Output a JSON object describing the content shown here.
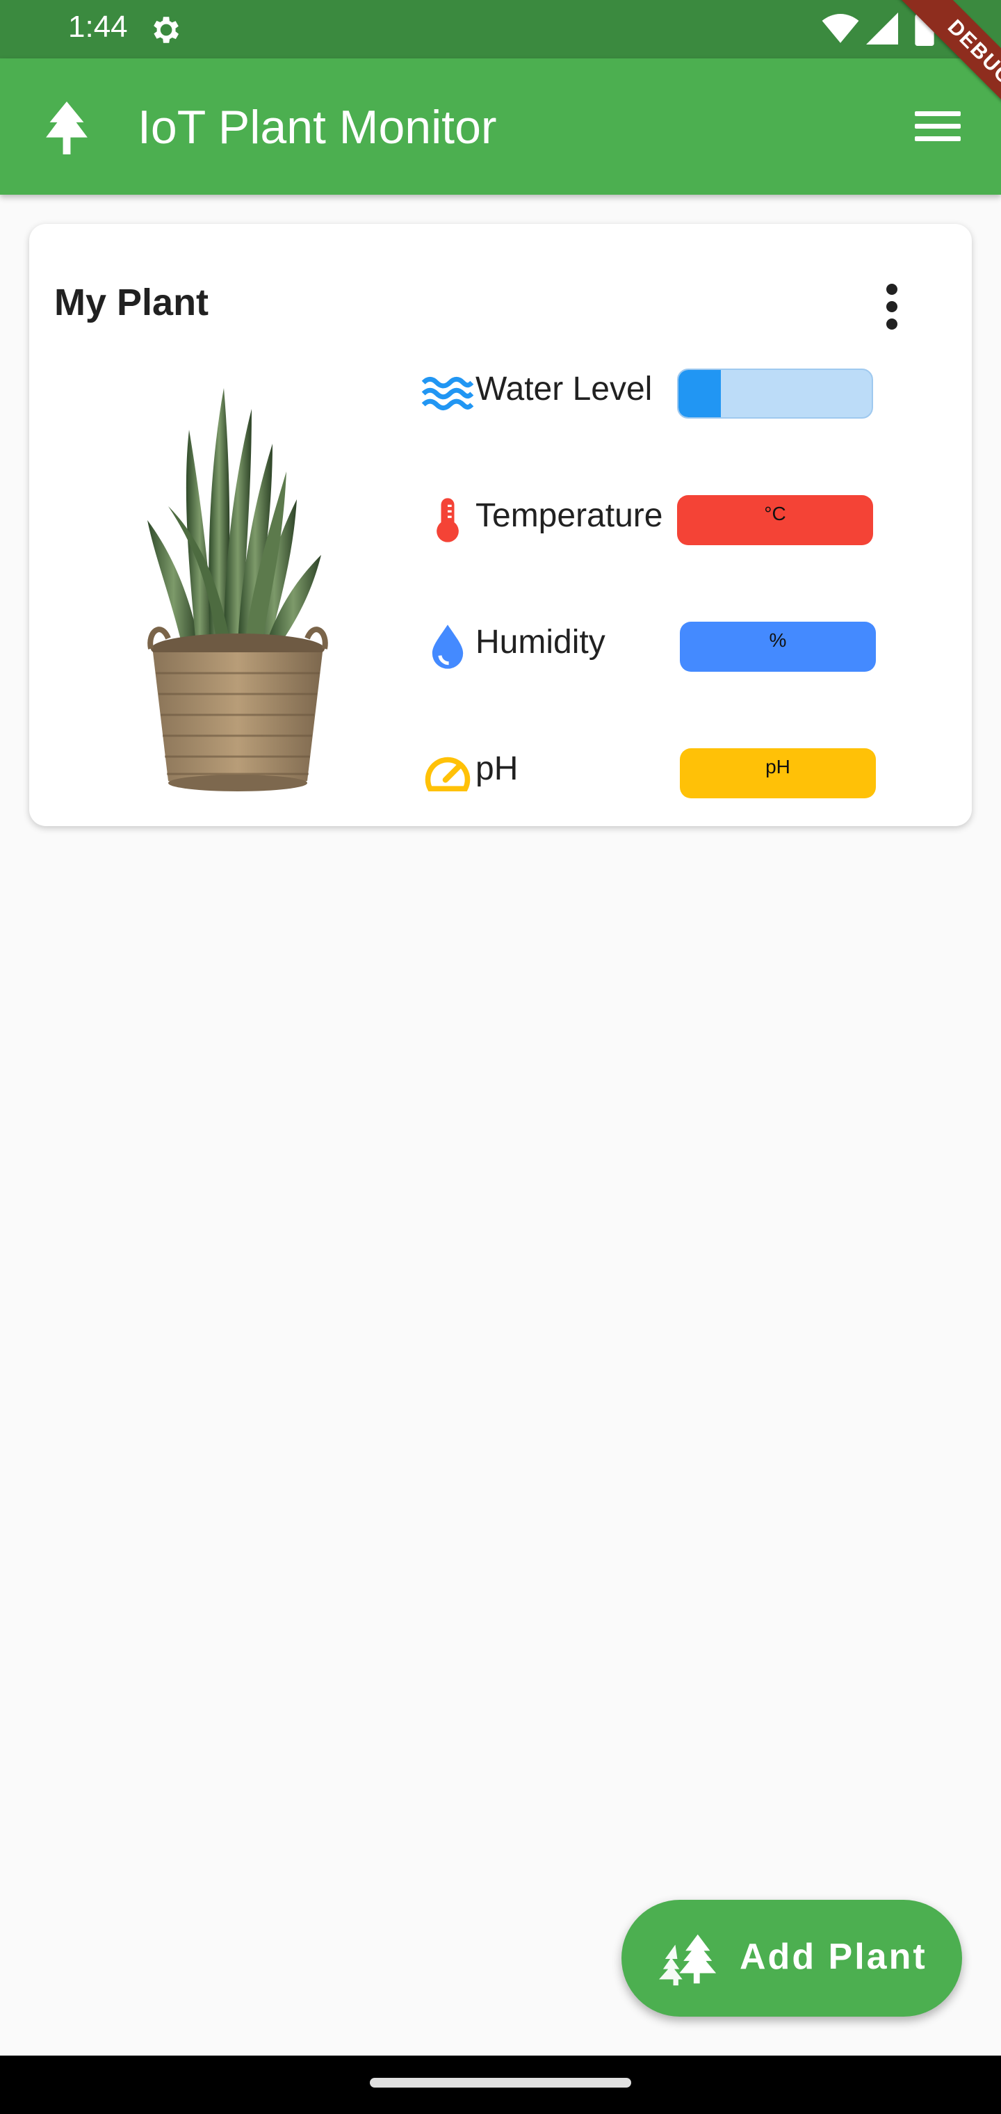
{
  "status_bar": {
    "time": "1:44",
    "icons": [
      "settings-icon",
      "wifi-icon",
      "signal-icon",
      "battery-icon"
    ]
  },
  "debug_banner": "DEBUG",
  "app_bar": {
    "title": "IoT Plant Monitor",
    "logo_icon": "tree-icon",
    "menu_icon": "hamburger-menu-icon",
    "color": "#4caf50"
  },
  "plant_card": {
    "name": "My Plant",
    "more_icon": "more-vert-icon",
    "image": "snake-plant-basket",
    "sensors": [
      {
        "id": "water",
        "label": "Water Level",
        "icon": "waves-icon",
        "bar_text": "",
        "fill_fraction": 0.22,
        "color": "#2196f3"
      },
      {
        "id": "temperature",
        "label": "Temperature",
        "icon": "thermometer-icon",
        "bar_text": "°C",
        "color": "#f44336"
      },
      {
        "id": "humidity",
        "label": "Humidity",
        "icon": "water-drop-icon",
        "bar_text": "%",
        "color": "#448aff"
      },
      {
        "id": "ph",
        "label": "pH",
        "icon": "speed-gauge-icon",
        "bar_text": "pH",
        "color": "#ffc107"
      }
    ]
  },
  "fab": {
    "label": "Add Plant",
    "icon": "forest-icon"
  }
}
